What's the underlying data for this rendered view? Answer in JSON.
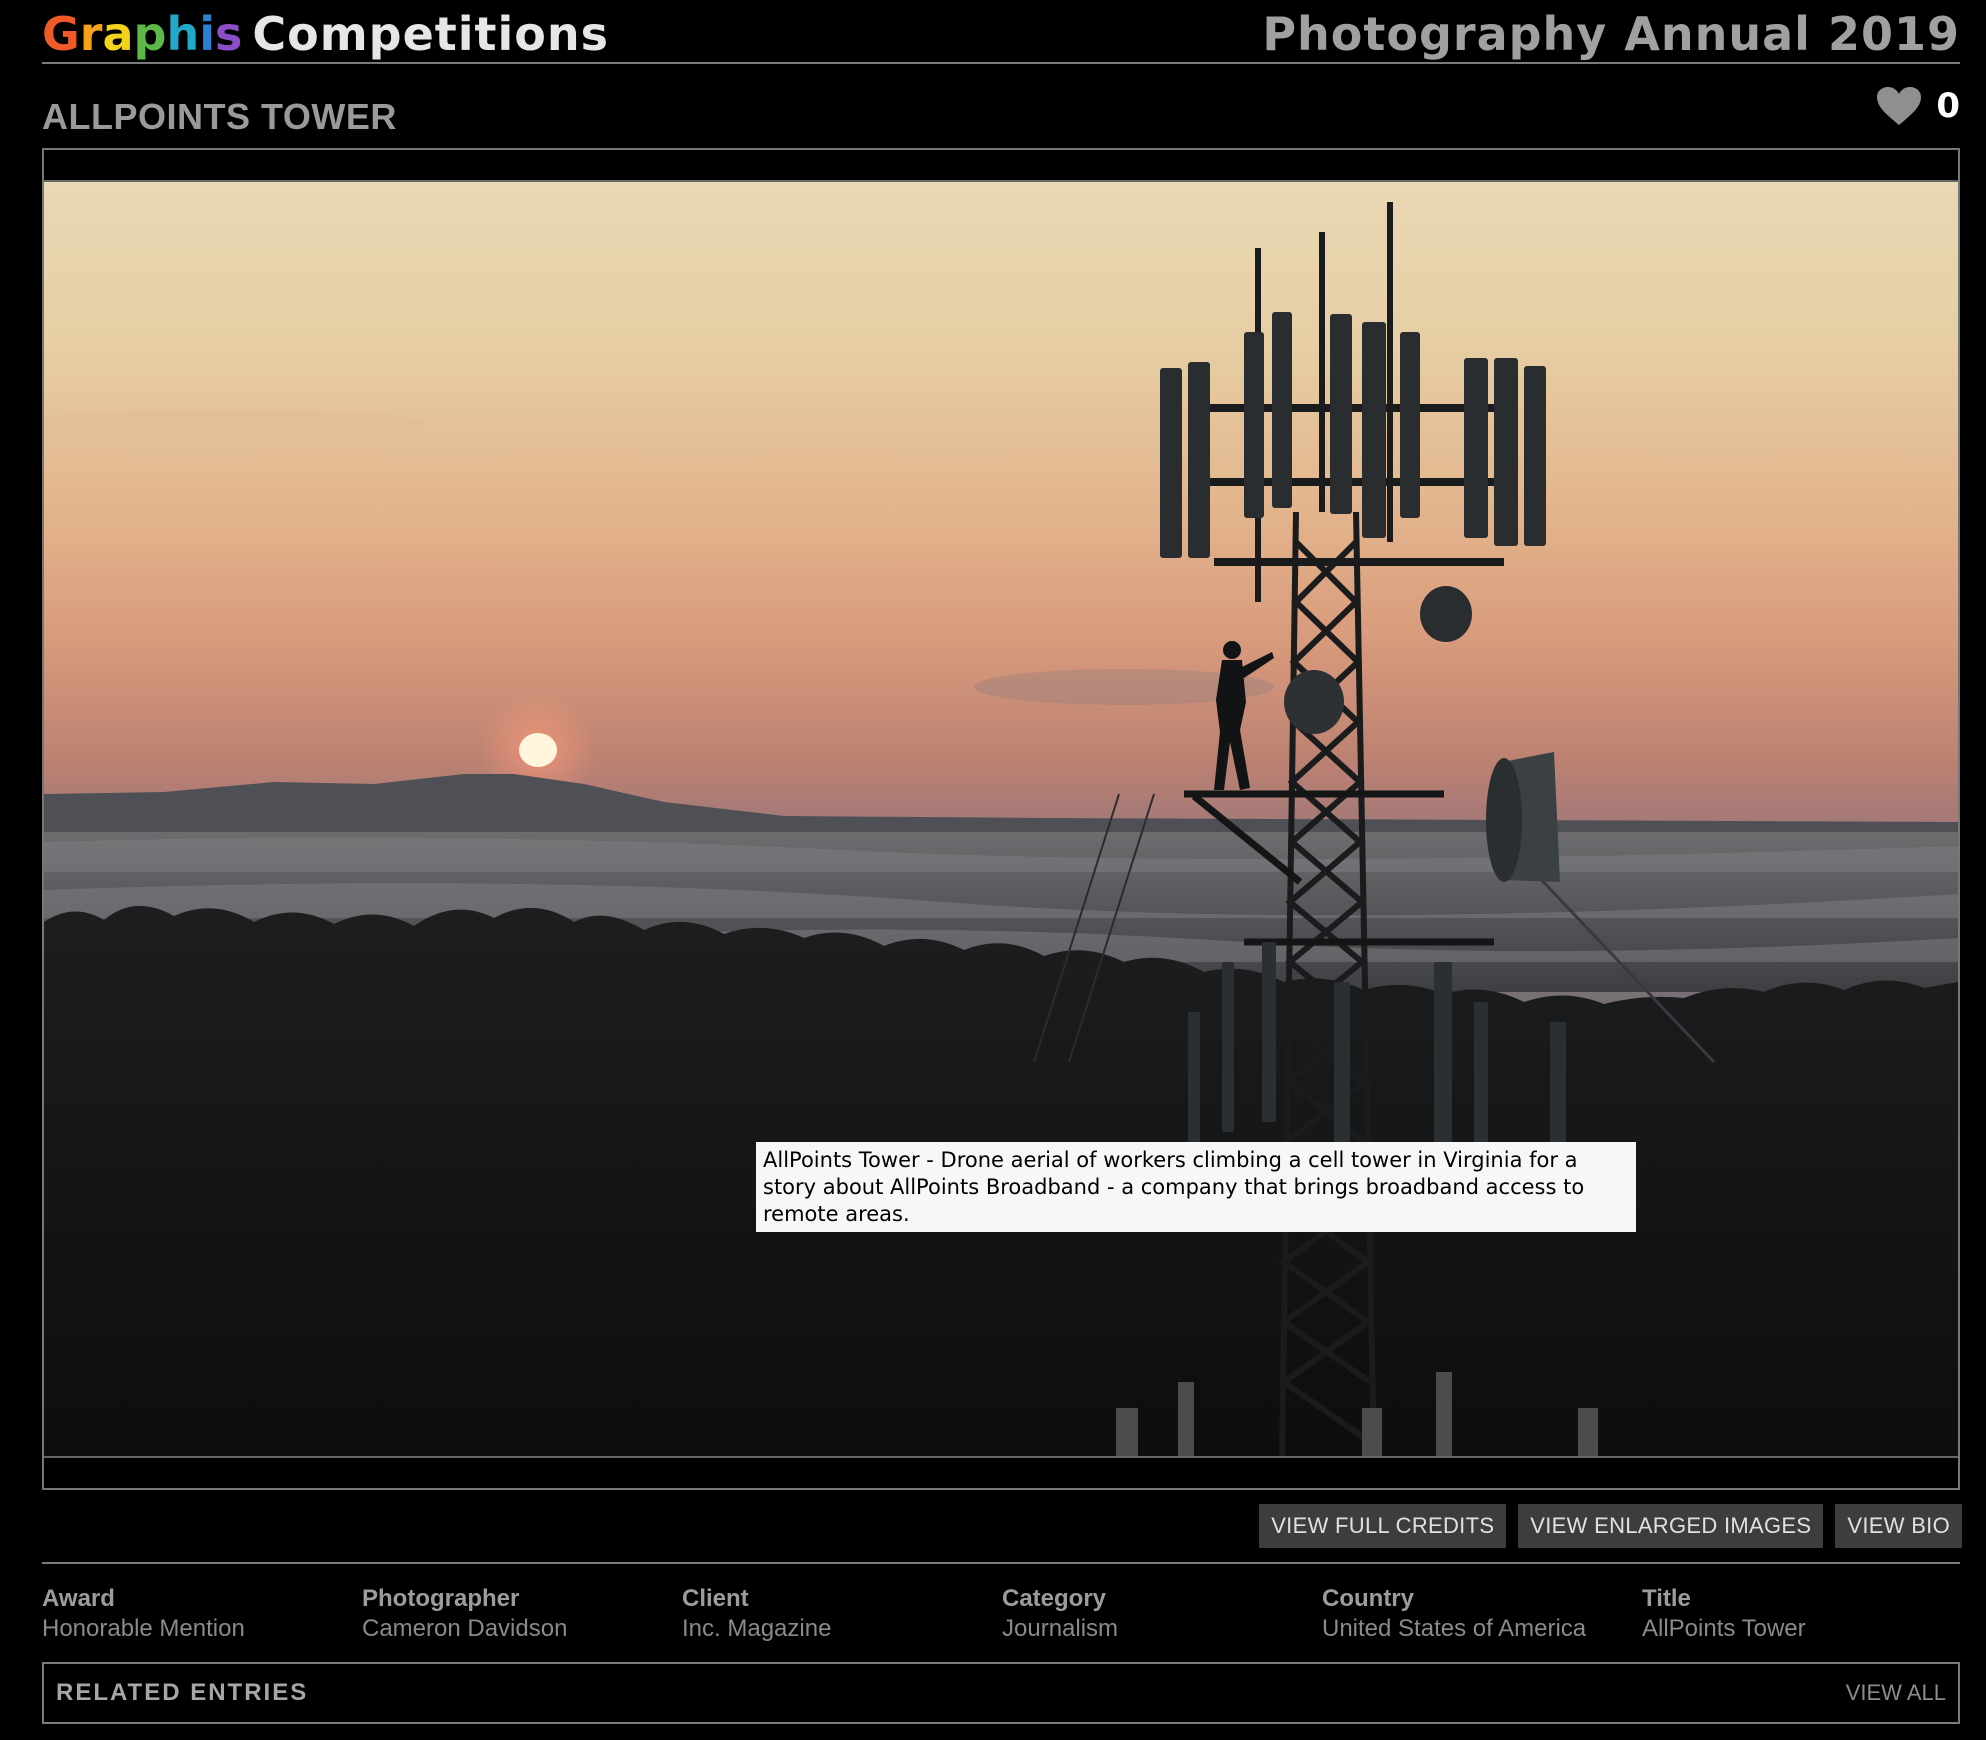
{
  "header": {
    "logo_graphis": "Graphis",
    "logo_competitions": "Competitions",
    "publication": "Photography Annual 2019"
  },
  "entry": {
    "title": "ALLPOINTS TOWER",
    "likes": "0",
    "caption": "AllPoints Tower - Drone aerial of workers climbing a cell tower in Virginia for a story about AllPoints Broadband - a company that brings broadband access to remote areas."
  },
  "actions": {
    "view_full_credits": "VIEW FULL CREDITS",
    "view_enlarged_images": "VIEW ENLARGED IMAGES",
    "view_bio": "VIEW BIO"
  },
  "details": [
    {
      "label": "Award",
      "value": "Honorable Mention"
    },
    {
      "label": "Photographer",
      "value": "Cameron Davidson"
    },
    {
      "label": "Client",
      "value": "Inc. Magazine"
    },
    {
      "label": "Category",
      "value": "Journalism"
    },
    {
      "label": "Country",
      "value": "United States of America"
    },
    {
      "label": "Title",
      "value": "AllPoints Tower"
    }
  ],
  "related": {
    "title": "RELATED ENTRIES",
    "view_all": "VIEW ALL"
  },
  "icons": {
    "like": "heart-icon"
  },
  "colors": {
    "background": "#000000",
    "button_bg": "#3d3d3d",
    "muted_text": "#9a9a9a"
  }
}
